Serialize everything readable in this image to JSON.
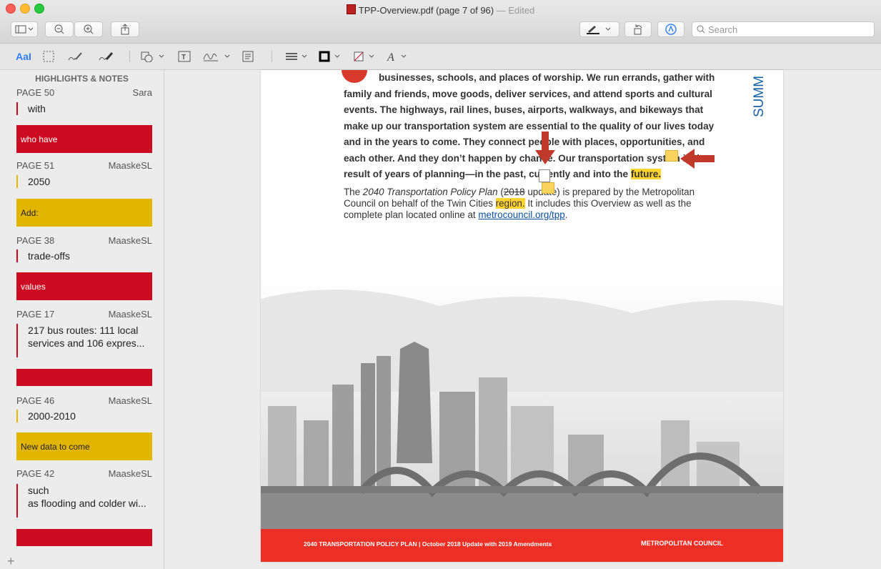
{
  "window": {
    "filename": "TPP-Overview.pdf",
    "page_info": "(page 7 of 96)",
    "status": "— Edited"
  },
  "toolbar": {
    "search_placeholder": "Search",
    "text_tool_label": "AaI"
  },
  "sidebar": {
    "header": "HIGHLIGHTS & NOTES",
    "notes": [
      {
        "page": "PAGE 50",
        "author": "Sara",
        "text": "with",
        "color": "red",
        "note": "who have"
      },
      {
        "page": "PAGE 51",
        "author": "MaaskeSL",
        "text": "2050",
        "color": "yellow",
        "note": "Add:"
      },
      {
        "page": "PAGE 38",
        "author": "MaaskeSL",
        "text": "trade-offs",
        "color": "red",
        "note": "values"
      },
      {
        "page": "PAGE 17",
        "author": "MaaskeSL",
        "text_line1": "217 bus routes: 111 local",
        "text_line2": "services and 106 expres...",
        "color": "red",
        "note": ""
      },
      {
        "page": "PAGE 46",
        "author": "MaaskeSL",
        "text": "2000-2010",
        "color": "yellow",
        "note": "New data to come"
      },
      {
        "page": "PAGE 42",
        "author": "MaaskeSL",
        "text_line1": "such",
        "text_line2": "as flooding and colder wi...",
        "color": "red",
        "note": ""
      }
    ],
    "add_label": "+"
  },
  "document": {
    "p1": {
      "l1": "businesses, schools, and places of worship. We run errands, gather with",
      "l2": "family and friends, move goods, deliver services, and attend sports and cultural",
      "l3": "events. The highways, rail lines, buses, airports, walkways, and bikeways that",
      "l4": "make up our transportation system are essential to the quality of our lives today",
      "l5": "and in the years to come. They connect people with places, opportunities, and",
      "l6a": "each other. And they don’t happen by chance. Our transportation system is the",
      "l7a": "result of years of planning—in the past, currently and into the ",
      "l7b": "future."
    },
    "p2": {
      "a": "The ",
      "b": "2040 Transportation Policy Plan",
      "c": " (",
      "d": "2018",
      "e": " update) is prepared by the Metropolitan",
      "f": "Council on behalf of the Twin Cities ",
      "g": "region.",
      "h": " It includes this Overview as well as the",
      "i": "complete plan located online at ",
      "j": "metrocouncil.org/tpp",
      "k": "."
    },
    "side_heading": "SUMM",
    "footer_left": "2040 TRANSPORTATION POLICY PLAN | October 2018 Update with 2019 Amendments",
    "footer_right": "METROPOLITAN COUNCIL"
  },
  "colors": {
    "highlight_yellow": "#ffd42e",
    "note_red": "#cc0a21",
    "note_yellow": "#e2b600",
    "footer_red": "#ee2f25",
    "link_blue": "#0b4f9c"
  }
}
